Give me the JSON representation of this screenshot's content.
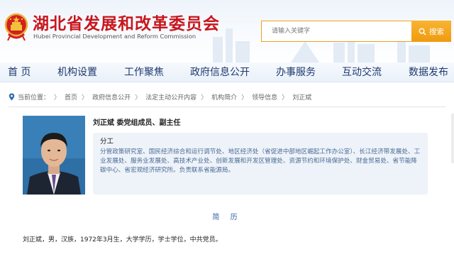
{
  "header": {
    "title_cn": "湖北省发展和改革委员会",
    "title_en": "Hubei Provincial Development and Reform Commission",
    "search_placeholder": "请输入关键字",
    "search_button": "搜索",
    "colors": {
      "title": "#c8161d",
      "search_accent": "#f09a10",
      "nav_text": "#1e3a6e"
    }
  },
  "nav": {
    "items": [
      "首 页",
      "机构设置",
      "工作聚焦",
      "政府信息公开",
      "办事服务",
      "互动交流",
      "数据发布"
    ]
  },
  "breadcrumb": {
    "prefix": "当前位置：",
    "items": [
      "首页",
      "政府信息公开",
      "法定主动公开内容",
      "机构简介",
      "领导信息",
      "刘正斌"
    ],
    "separator": "〉"
  },
  "profile": {
    "name_title": "刘正斌  委党组成员、副主任",
    "duty_label": "分工",
    "duty_text": "分管政策研究室、国民经济综合和运行调节处、地区经济处（省促进中部地区崛起工作办公室）、长江经济带发展处、工业发展处、服务业发展处、高技术产业处、创新发展和开发区管理处、资源节约和环境保护处、财金贸易处、省节能降碳中心、省宏观经济研究所。负责联系省能源局。",
    "section_title": "简 历",
    "bio": "刘正斌，男，汉族，1972年3月生，大学学历，学士学位，中共党员。"
  },
  "icons": {
    "emblem": "national-emblem-icon",
    "search": "search-icon",
    "location": "location-pin-icon"
  }
}
